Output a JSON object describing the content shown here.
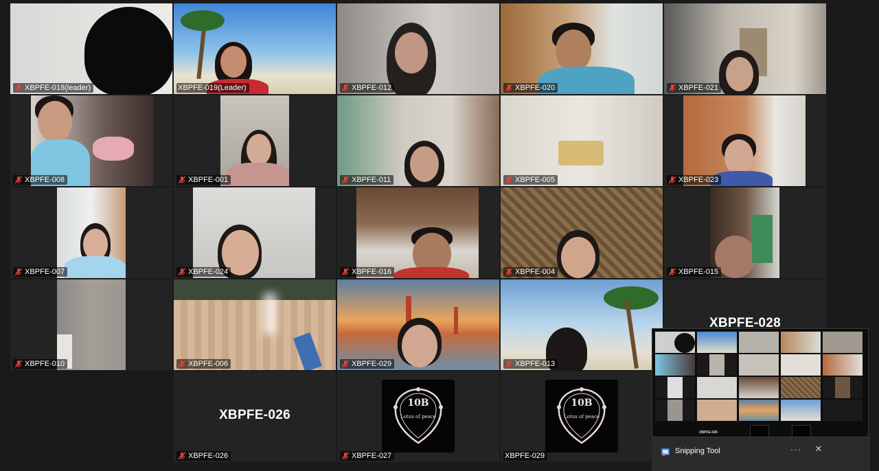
{
  "participants": [
    {
      "id": "p018",
      "label": "XBPFE-018(leader)"
    },
    {
      "id": "p019",
      "label": "XBPFE-019(Leader)"
    },
    {
      "id": "p012",
      "label": "XBPFE-012"
    },
    {
      "id": "p020",
      "label": "XBPFE-020"
    },
    {
      "id": "p021",
      "label": "XBPFE-021"
    },
    {
      "id": "p008",
      "label": "XBPFE-008"
    },
    {
      "id": "p001",
      "label": "XBPFE-001"
    },
    {
      "id": "p011",
      "label": "XBPFE-011"
    },
    {
      "id": "p005",
      "label": "XBPFE-005"
    },
    {
      "id": "p023",
      "label": "XBPFE-023"
    },
    {
      "id": "p007",
      "label": "XBPFE-007"
    },
    {
      "id": "p024",
      "label": "XBPFE-024"
    },
    {
      "id": "p016",
      "label": "XBPFE-016"
    },
    {
      "id": "p004",
      "label": "XBPFE-004"
    },
    {
      "id": "p015",
      "label": "XBPFE-015"
    },
    {
      "id": "p010",
      "label": "XBPFE-010"
    },
    {
      "id": "p006",
      "label": "XBPFE-006"
    },
    {
      "id": "p029v",
      "label": "XBPFE-029"
    },
    {
      "id": "p013",
      "label": "XBPFE-013"
    },
    {
      "id": "p028",
      "label": "XBPFE-028",
      "big_name": "XBPFE-028"
    },
    {
      "id": "p026",
      "label": "XBPFE-026",
      "big_name": "XBPFE-026"
    },
    {
      "id": "p027",
      "label": "XBPFE-027"
    },
    {
      "id": "p029",
      "label": "XBPFE-029"
    }
  ],
  "logo": {
    "title": "10B",
    "subtitle": "Lotus of peace"
  },
  "mini_preview": {
    "label": "XBPFE-028"
  },
  "snipping_toast": {
    "app_name": "Snipping Tool",
    "more_label": "···",
    "close_label": "✕"
  },
  "colors": {
    "active_border": "#23d959",
    "mute_icon": "#e0443a",
    "tile_bg": "#232323"
  }
}
